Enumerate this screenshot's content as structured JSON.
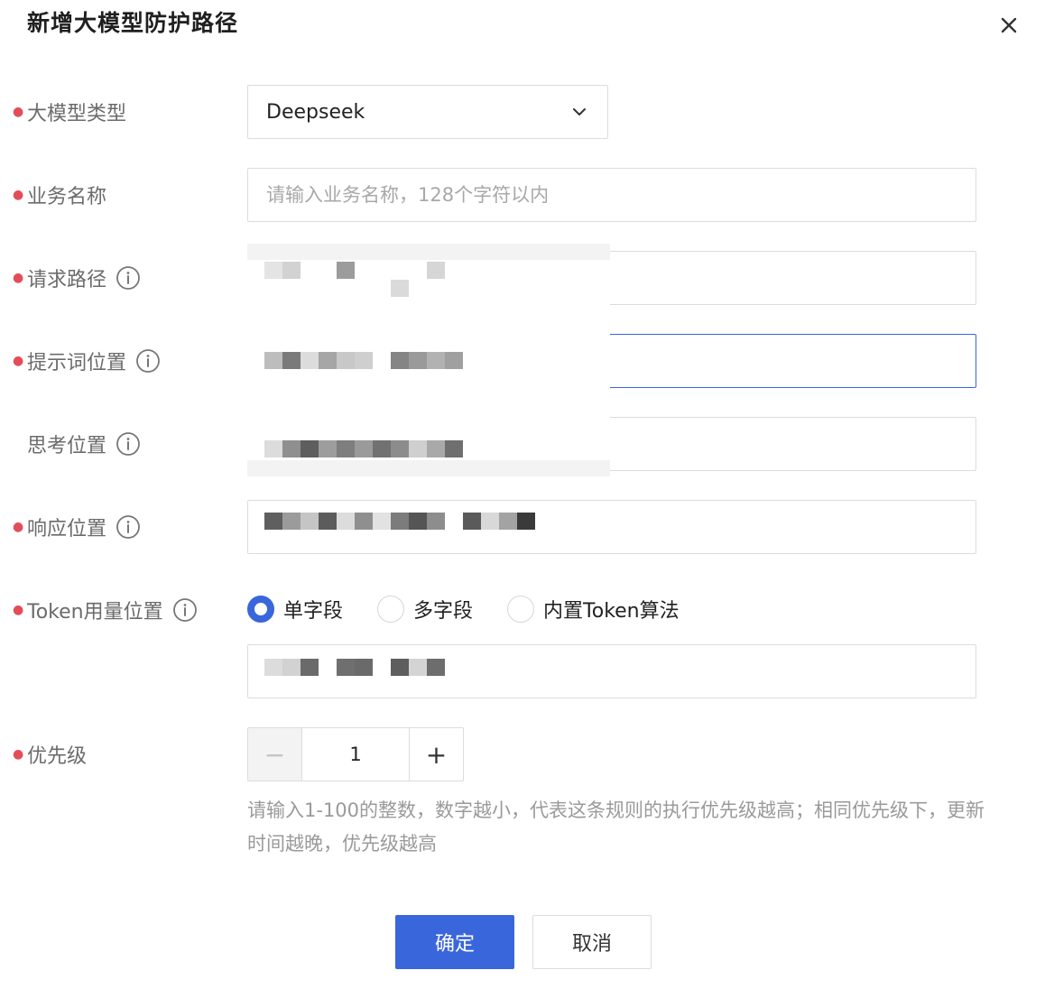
{
  "dialog": {
    "title": "新增大模型防护路径"
  },
  "form": {
    "model_type": {
      "label": "大模型类型",
      "required": true,
      "value": "Deepseek"
    },
    "business_name": {
      "label": "业务名称",
      "required": true,
      "placeholder": "请输入业务名称，128个字符以内",
      "value": ""
    },
    "request_path": {
      "label": "请求路径",
      "required": true
    },
    "prompt_position": {
      "label": "提示词位置",
      "required": true
    },
    "thinking_position": {
      "label": "思考位置",
      "required": false
    },
    "response_position": {
      "label": "响应位置",
      "required": true
    },
    "token_position": {
      "label": "Token用量位置",
      "required": true,
      "options": [
        {
          "label": "单字段",
          "checked": true
        },
        {
          "label": "多字段",
          "checked": false
        },
        {
          "label": "内置Token算法",
          "checked": false
        }
      ]
    },
    "priority": {
      "label": "优先级",
      "required": true,
      "value": "1",
      "minus": "−",
      "plus": "+",
      "hint": "请输入1-100的整数，数字越小，代表这条规则的执行优先级越高；相同优先级下，更新时间越晚，优先级越高"
    }
  },
  "footer": {
    "confirm_label": "确定",
    "cancel_label": "取消"
  },
  "colors": {
    "primary": "#3a66dc",
    "required": "#e34d59",
    "border": "#dcdcdc",
    "placeholder": "#a8a8a8"
  },
  "icons": {
    "close": "close-icon",
    "info": "info-circle-icon",
    "dropdown": "chevron-down-icon"
  }
}
